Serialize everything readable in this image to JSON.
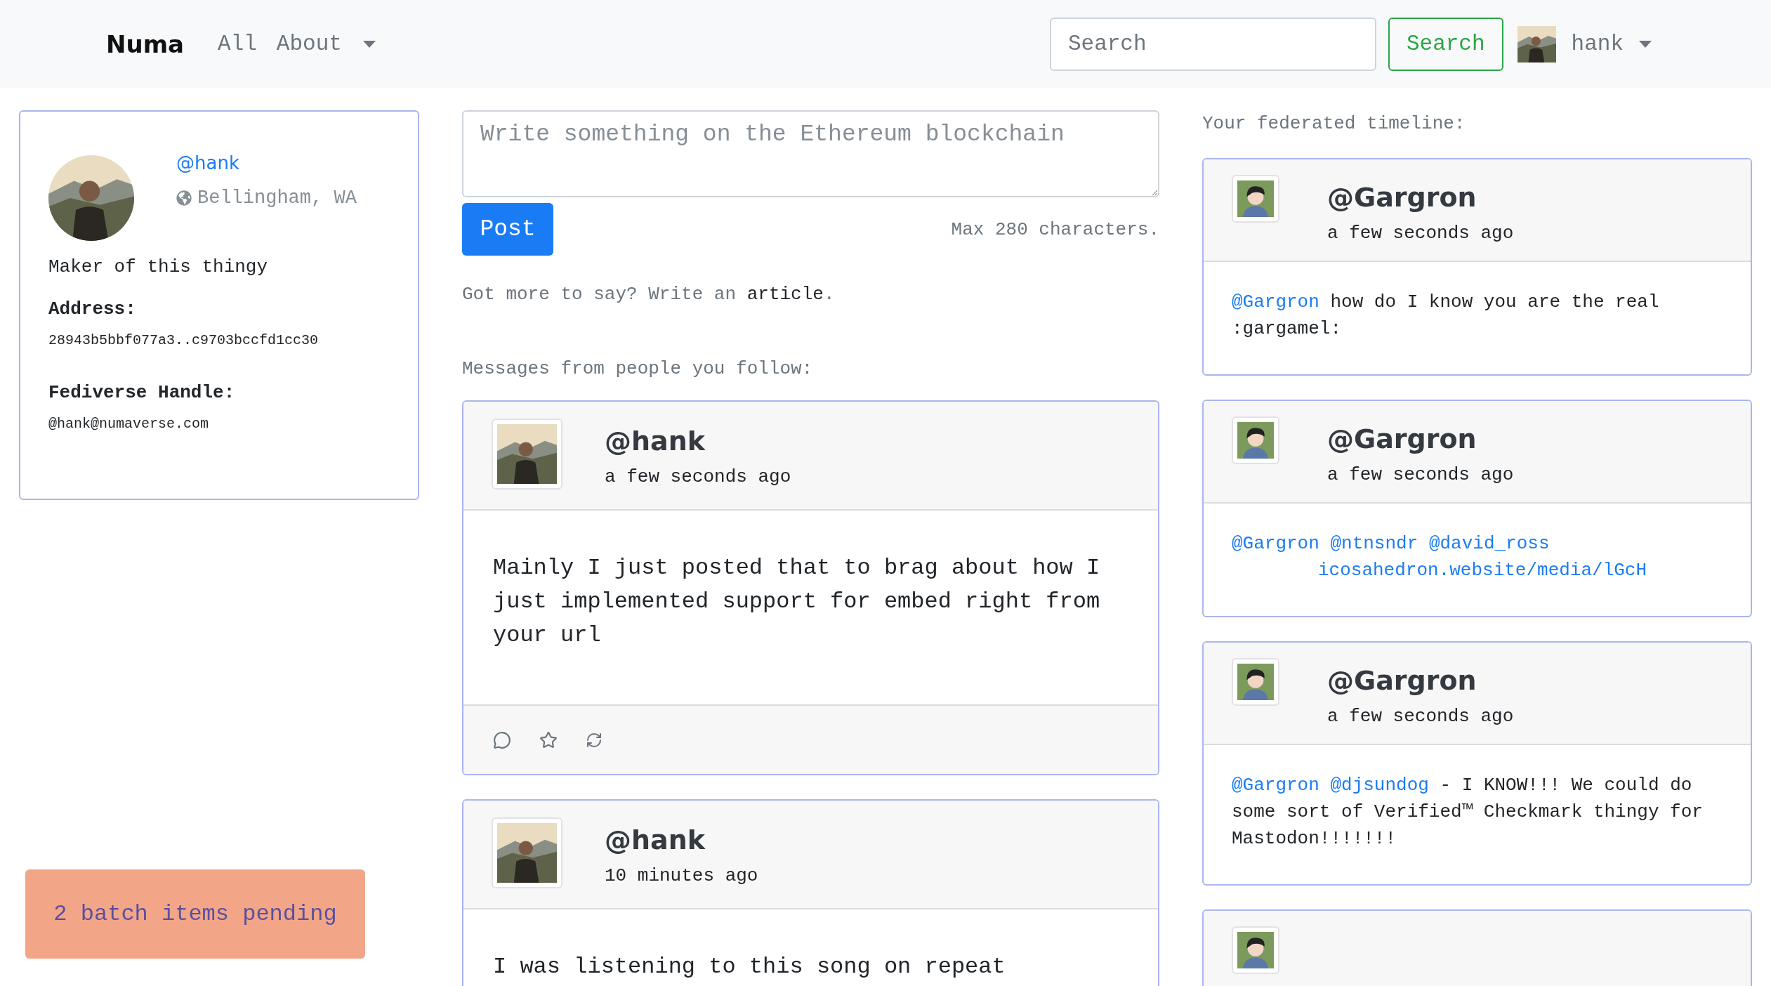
{
  "nav": {
    "brand": "Numa",
    "links": [
      {
        "label": "All",
        "kind": "link"
      },
      {
        "label": "About",
        "kind": "dropdown"
      }
    ],
    "search": {
      "placeholder": "Search",
      "button": "Search"
    },
    "user": {
      "name": "hank"
    }
  },
  "profile": {
    "handle": "@hank",
    "location": "Bellingham, WA",
    "bio": "Maker of this thingy",
    "fields": [
      {
        "label": "Address:",
        "value": "28943b5bbf077a3..c9703bccfd1cc30"
      },
      {
        "label": "Fediverse Handle:",
        "value": "@hank@numaverse.com"
      }
    ]
  },
  "batch": {
    "text": "2 batch items pending"
  },
  "composer": {
    "placeholder": "Write something on the Ethereum blockchain",
    "button": "Post",
    "limit": "Max 280 characters.",
    "more": "Got more to say? Write an",
    "more_link": "article",
    "more_end": "."
  },
  "follow_heading": "Messages from people you follow:",
  "posts": [
    {
      "handle": "@hank",
      "time": "a few seconds ago",
      "body": "Mainly I just posted that to brag about how I just implemented support for embed right from your url",
      "actions": [
        {
          "kind": "comment"
        },
        {
          "kind": "star"
        },
        {
          "kind": "repost"
        }
      ]
    },
    {
      "handle": "@hank",
      "time": "10 minutes ago",
      "body": "I was listening to this song on repeat"
    }
  ],
  "timeline_heading": "Your federated timeline:",
  "timeline": [
    {
      "kind": "post",
      "handle": "@Gargron",
      "time": "a few seconds ago",
      "body": [
        {
          "kind": "mention",
          "text": "@Gargron"
        },
        {
          "kind": "text",
          "text": " how do I know you are the real :gargamel:"
        }
      ]
    },
    {
      "kind": "post",
      "handle": "@Gargron",
      "time": "a few seconds ago",
      "body": [
        {
          "kind": "mention",
          "text": "@Gargron"
        },
        {
          "kind": "mention",
          "text": "@ntnsndr"
        },
        {
          "kind": "mention",
          "text": "@david_ross"
        },
        {
          "kind": "url",
          "text": "icosahedron.website/media/lGcH"
        }
      ]
    },
    {
      "kind": "post",
      "handle": "@Gargron",
      "time": "a few seconds ago",
      "body": [
        {
          "kind": "mention",
          "text": "@Gargron"
        },
        {
          "kind": "mention",
          "text": "@djsundog"
        },
        {
          "kind": "text",
          "text": " - I KNOW!!! We could do some sort of Verified™ Checkmark thingy for Mastodon!!!!!!!"
        }
      ]
    },
    {
      "kind": "stub"
    }
  ]
}
